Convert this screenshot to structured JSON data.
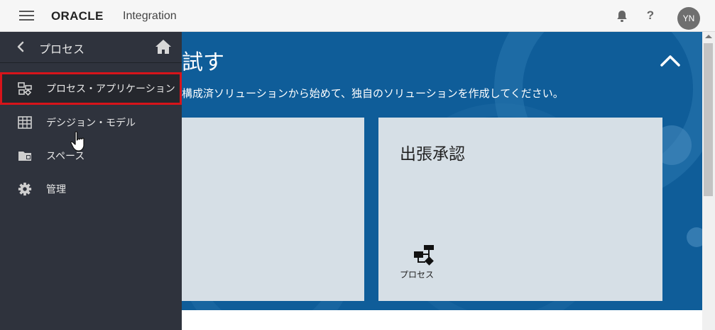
{
  "header": {
    "brand": "ORACLE",
    "product": "Integration",
    "help_label": "?",
    "user_initials": "YN"
  },
  "hero": {
    "title": "試す",
    "subtitle": "構成済ソリューションから始めて、独自のソリューションを作成してください。",
    "card": {
      "title": "出張承認",
      "tag": "プロセス"
    }
  },
  "drawer": {
    "title": "プロセス",
    "items": [
      {
        "label": "プロセス・アプリケーション",
        "icon": "process-flow-icon",
        "selected": true
      },
      {
        "label": "デシジョン・モデル",
        "icon": "table-grid-icon"
      },
      {
        "label": "スペース",
        "icon": "folder-icon"
      },
      {
        "label": "管理",
        "icon": "gear-icon"
      }
    ]
  },
  "colors": {
    "drawer_bg": "#2f333d",
    "hero_bg": "#0f5d99",
    "card_bg": "#d6dfe6",
    "highlight": "#d7141a"
  }
}
